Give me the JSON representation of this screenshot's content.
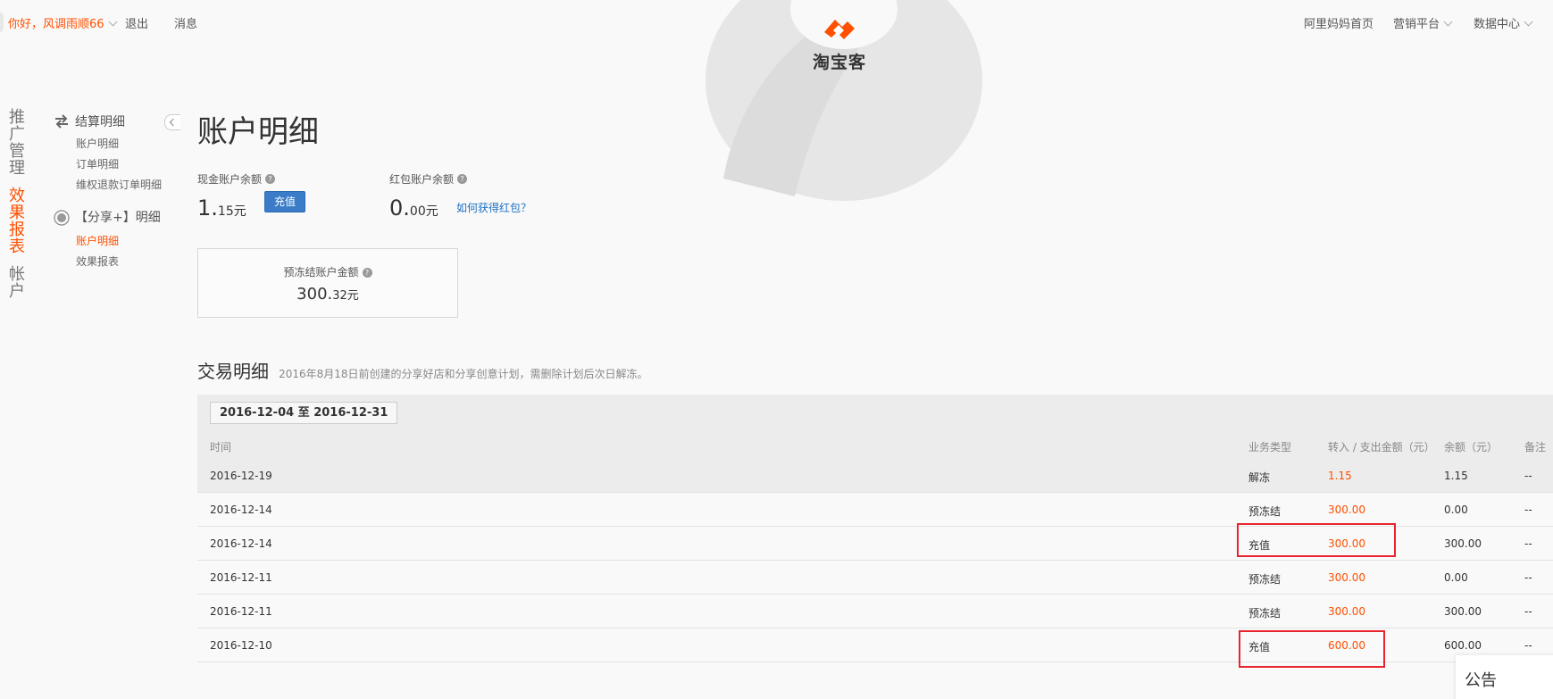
{
  "topbar": {
    "greeting": "你好，风调雨顺66",
    "logout": "退出",
    "messages": "消息",
    "right_links": [
      "阿里妈妈首页",
      "营销平台",
      "数据中心"
    ]
  },
  "logo": {
    "text": "淘宝客",
    "accent_color": "#ff5000"
  },
  "vnav": [
    "推广管理",
    "效果报表",
    "帐户"
  ],
  "vnav_active_index": 1,
  "submenu": {
    "group1_title": "结算明细",
    "group1_items": [
      "账户明细",
      "订单明细",
      "维权退款订单明细"
    ],
    "group2_title": "【分享+】明细",
    "group2_items": [
      "账户明细",
      "效果报表"
    ]
  },
  "page_title": "账户明细",
  "cash": {
    "label": "现金账户余额",
    "int": "1.",
    "dec": "15",
    "unit": "元",
    "recharge": "充值"
  },
  "hongbao": {
    "label": "红包账户余额",
    "int": "0.",
    "dec": "00",
    "unit": "元",
    "link": "如何获得红包？"
  },
  "freeze": {
    "label": "预冻结账户金额",
    "int": "300.",
    "dec": "32",
    "unit": "元"
  },
  "transactions": {
    "title": "交易明细",
    "note": "2016年8月18日前创建的分享好店和分享创意计划，需删除计划后次日解冻。",
    "date_range": "2016-12-04 至 2016-12-31",
    "headers": {
      "time": "时间",
      "type": "业务类型",
      "amount": "转入 / 支出金额（元）",
      "balance": "余额（元）",
      "remark": "备注"
    },
    "rows": [
      {
        "time": "2016-12-19",
        "type": "解冻",
        "amount": "1.15",
        "balance": "1.15",
        "remark": "--"
      },
      {
        "time": "2016-12-14",
        "type": "预冻结",
        "amount": "300.00",
        "balance": "0.00",
        "remark": "--"
      },
      {
        "time": "2016-12-14",
        "type": "充值",
        "amount": "300.00",
        "balance": "300.00",
        "remark": "--"
      },
      {
        "time": "2016-12-11",
        "type": "预冻结",
        "amount": "300.00",
        "balance": "0.00",
        "remark": "--"
      },
      {
        "time": "2016-12-11",
        "type": "预冻结",
        "amount": "300.00",
        "balance": "300.00",
        "remark": "--"
      },
      {
        "time": "2016-12-10",
        "type": "充值",
        "amount": "600.00",
        "balance": "600.00",
        "remark": "--"
      }
    ]
  },
  "announcement": "公告"
}
